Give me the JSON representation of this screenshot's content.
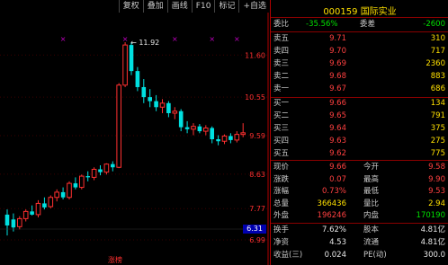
{
  "toolbar": [
    {
      "label": "复权"
    },
    {
      "label": "叠加"
    },
    {
      "label": "画线"
    },
    {
      "label": "F10"
    },
    {
      "label": "标记"
    },
    {
      "label": "+自选"
    }
  ],
  "chart": {
    "high_label": "11.92",
    "price_tag": "6.31",
    "bottom_label": "涨榜",
    "axis_labels": [
      "11.60",
      "10.55",
      "9.59",
      "8.63",
      "7.77",
      "6.99"
    ],
    "candles": [
      {
        "o": 7.35,
        "h": 7.75,
        "l": 7.1,
        "c": 7.62,
        "up": false
      },
      {
        "o": 7.5,
        "h": 7.65,
        "l": 7.2,
        "c": 7.3,
        "up": false
      },
      {
        "o": 7.32,
        "h": 7.58,
        "l": 7.25,
        "c": 7.52,
        "up": true
      },
      {
        "o": 7.52,
        "h": 7.75,
        "l": 7.45,
        "c": 7.7,
        "up": true
      },
      {
        "o": 7.7,
        "h": 7.85,
        "l": 7.6,
        "c": 7.62,
        "up": false
      },
      {
        "o": 7.62,
        "h": 7.98,
        "l": 7.55,
        "c": 7.9,
        "up": true
      },
      {
        "o": 7.9,
        "h": 8.05,
        "l": 7.75,
        "c": 7.8,
        "up": false
      },
      {
        "o": 7.82,
        "h": 8.1,
        "l": 7.78,
        "c": 8.05,
        "up": true
      },
      {
        "o": 8.05,
        "h": 8.25,
        "l": 7.95,
        "c": 8.18,
        "up": true
      },
      {
        "o": 8.18,
        "h": 8.3,
        "l": 8.0,
        "c": 8.05,
        "up": false
      },
      {
        "o": 8.05,
        "h": 8.45,
        "l": 8.0,
        "c": 8.4,
        "up": true
      },
      {
        "o": 8.4,
        "h": 8.55,
        "l": 8.25,
        "c": 8.3,
        "up": false
      },
      {
        "o": 8.3,
        "h": 8.62,
        "l": 8.25,
        "c": 8.58,
        "up": true
      },
      {
        "o": 8.58,
        "h": 8.7,
        "l": 8.45,
        "c": 8.55,
        "up": false
      },
      {
        "o": 8.55,
        "h": 8.8,
        "l": 8.48,
        "c": 8.75,
        "up": true
      },
      {
        "o": 8.75,
        "h": 8.85,
        "l": 8.6,
        "c": 8.68,
        "up": false
      },
      {
        "o": 8.68,
        "h": 8.9,
        "l": 8.62,
        "c": 8.88,
        "up": true
      },
      {
        "o": 8.88,
        "h": 8.95,
        "l": 8.7,
        "c": 8.8,
        "up": false
      },
      {
        "o": 8.8,
        "h": 10.9,
        "l": 8.78,
        "c": 10.85,
        "up": true
      },
      {
        "o": 10.85,
        "h": 11.92,
        "l": 10.8,
        "c": 11.85,
        "up": true
      },
      {
        "o": 11.85,
        "h": 11.92,
        "l": 11.1,
        "c": 11.2,
        "up": false
      },
      {
        "o": 11.2,
        "h": 11.3,
        "l": 10.7,
        "c": 10.8,
        "up": false
      },
      {
        "o": 10.8,
        "h": 11.0,
        "l": 10.4,
        "c": 10.55,
        "up": false
      },
      {
        "o": 10.55,
        "h": 10.75,
        "l": 10.3,
        "c": 10.45,
        "up": false
      },
      {
        "o": 10.45,
        "h": 10.6,
        "l": 10.2,
        "c": 10.3,
        "up": false
      },
      {
        "o": 10.3,
        "h": 10.5,
        "l": 10.15,
        "c": 10.4,
        "up": true
      },
      {
        "o": 10.4,
        "h": 10.45,
        "l": 10.05,
        "c": 10.15,
        "up": false
      },
      {
        "o": 10.15,
        "h": 10.3,
        "l": 10.0,
        "c": 10.2,
        "up": true
      },
      {
        "o": 10.2,
        "h": 10.25,
        "l": 9.7,
        "c": 9.8,
        "up": false
      },
      {
        "o": 9.8,
        "h": 9.95,
        "l": 9.65,
        "c": 9.75,
        "up": false
      },
      {
        "o": 9.75,
        "h": 9.9,
        "l": 9.6,
        "c": 9.82,
        "up": true
      },
      {
        "o": 9.82,
        "h": 9.88,
        "l": 9.65,
        "c": 9.7,
        "up": false
      },
      {
        "o": 9.7,
        "h": 9.85,
        "l": 9.6,
        "c": 9.78,
        "up": true
      },
      {
        "o": 9.78,
        "h": 9.82,
        "l": 9.4,
        "c": 9.5,
        "up": false
      },
      {
        "o": 9.5,
        "h": 9.6,
        "l": 9.35,
        "c": 9.45,
        "up": false
      },
      {
        "o": 9.45,
        "h": 9.62,
        "l": 9.38,
        "c": 9.58,
        "up": true
      },
      {
        "o": 9.58,
        "h": 9.65,
        "l": 9.4,
        "c": 9.48,
        "up": false
      },
      {
        "o": 9.48,
        "h": 9.7,
        "l": 9.42,
        "c": 9.62,
        "up": true
      },
      {
        "o": 9.62,
        "h": 9.9,
        "l": 9.55,
        "c": 9.66,
        "up": true
      }
    ]
  },
  "quote": {
    "code": "000159",
    "name": "国际实业",
    "ratio": {
      "label": "委比",
      "value": "-35.56%",
      "diff_label": "委差",
      "diff": "-2600"
    },
    "asks": [
      {
        "label": "卖五",
        "price": "9.71",
        "vol": "310"
      },
      {
        "label": "卖四",
        "price": "9.70",
        "vol": "717"
      },
      {
        "label": "卖三",
        "price": "9.69",
        "vol": "2360"
      },
      {
        "label": "卖二",
        "price": "9.68",
        "vol": "883"
      },
      {
        "label": "卖一",
        "price": "9.67",
        "vol": "686"
      }
    ],
    "bids": [
      {
        "label": "买一",
        "price": "9.66",
        "vol": "134"
      },
      {
        "label": "买二",
        "price": "9.65",
        "vol": "791"
      },
      {
        "label": "买三",
        "price": "9.64",
        "vol": "375"
      },
      {
        "label": "买四",
        "price": "9.63",
        "vol": "275"
      },
      {
        "label": "买五",
        "price": "9.62",
        "vol": "775"
      }
    ],
    "stats": [
      {
        "l1": "现价",
        "v1": "9.66",
        "l2": "今开",
        "v2": "9.58"
      },
      {
        "l1": "涨跌",
        "v1": "0.07",
        "l2": "最高",
        "v2": "9.90"
      },
      {
        "l1": "涨幅",
        "v1": "0.73%",
        "l2": "最低",
        "v2": "9.53"
      },
      {
        "l1": "总量",
        "v1": "366436",
        "l2": "量比",
        "v2": "2.94"
      },
      {
        "l1": "外盘",
        "v1": "196246",
        "l2": "内盘",
        "v2": "170190"
      }
    ],
    "extra": [
      {
        "l1": "换手",
        "v1": "7.62%",
        "l2": "股本",
        "v2": "4.81亿"
      },
      {
        "l1": "净资",
        "v1": "4.53",
        "l2": "流通",
        "v2": "4.81亿"
      },
      {
        "l1": "收益(三)",
        "v1": "0.024",
        "l2": "PE(动)",
        "v2": "300.0"
      }
    ]
  }
}
